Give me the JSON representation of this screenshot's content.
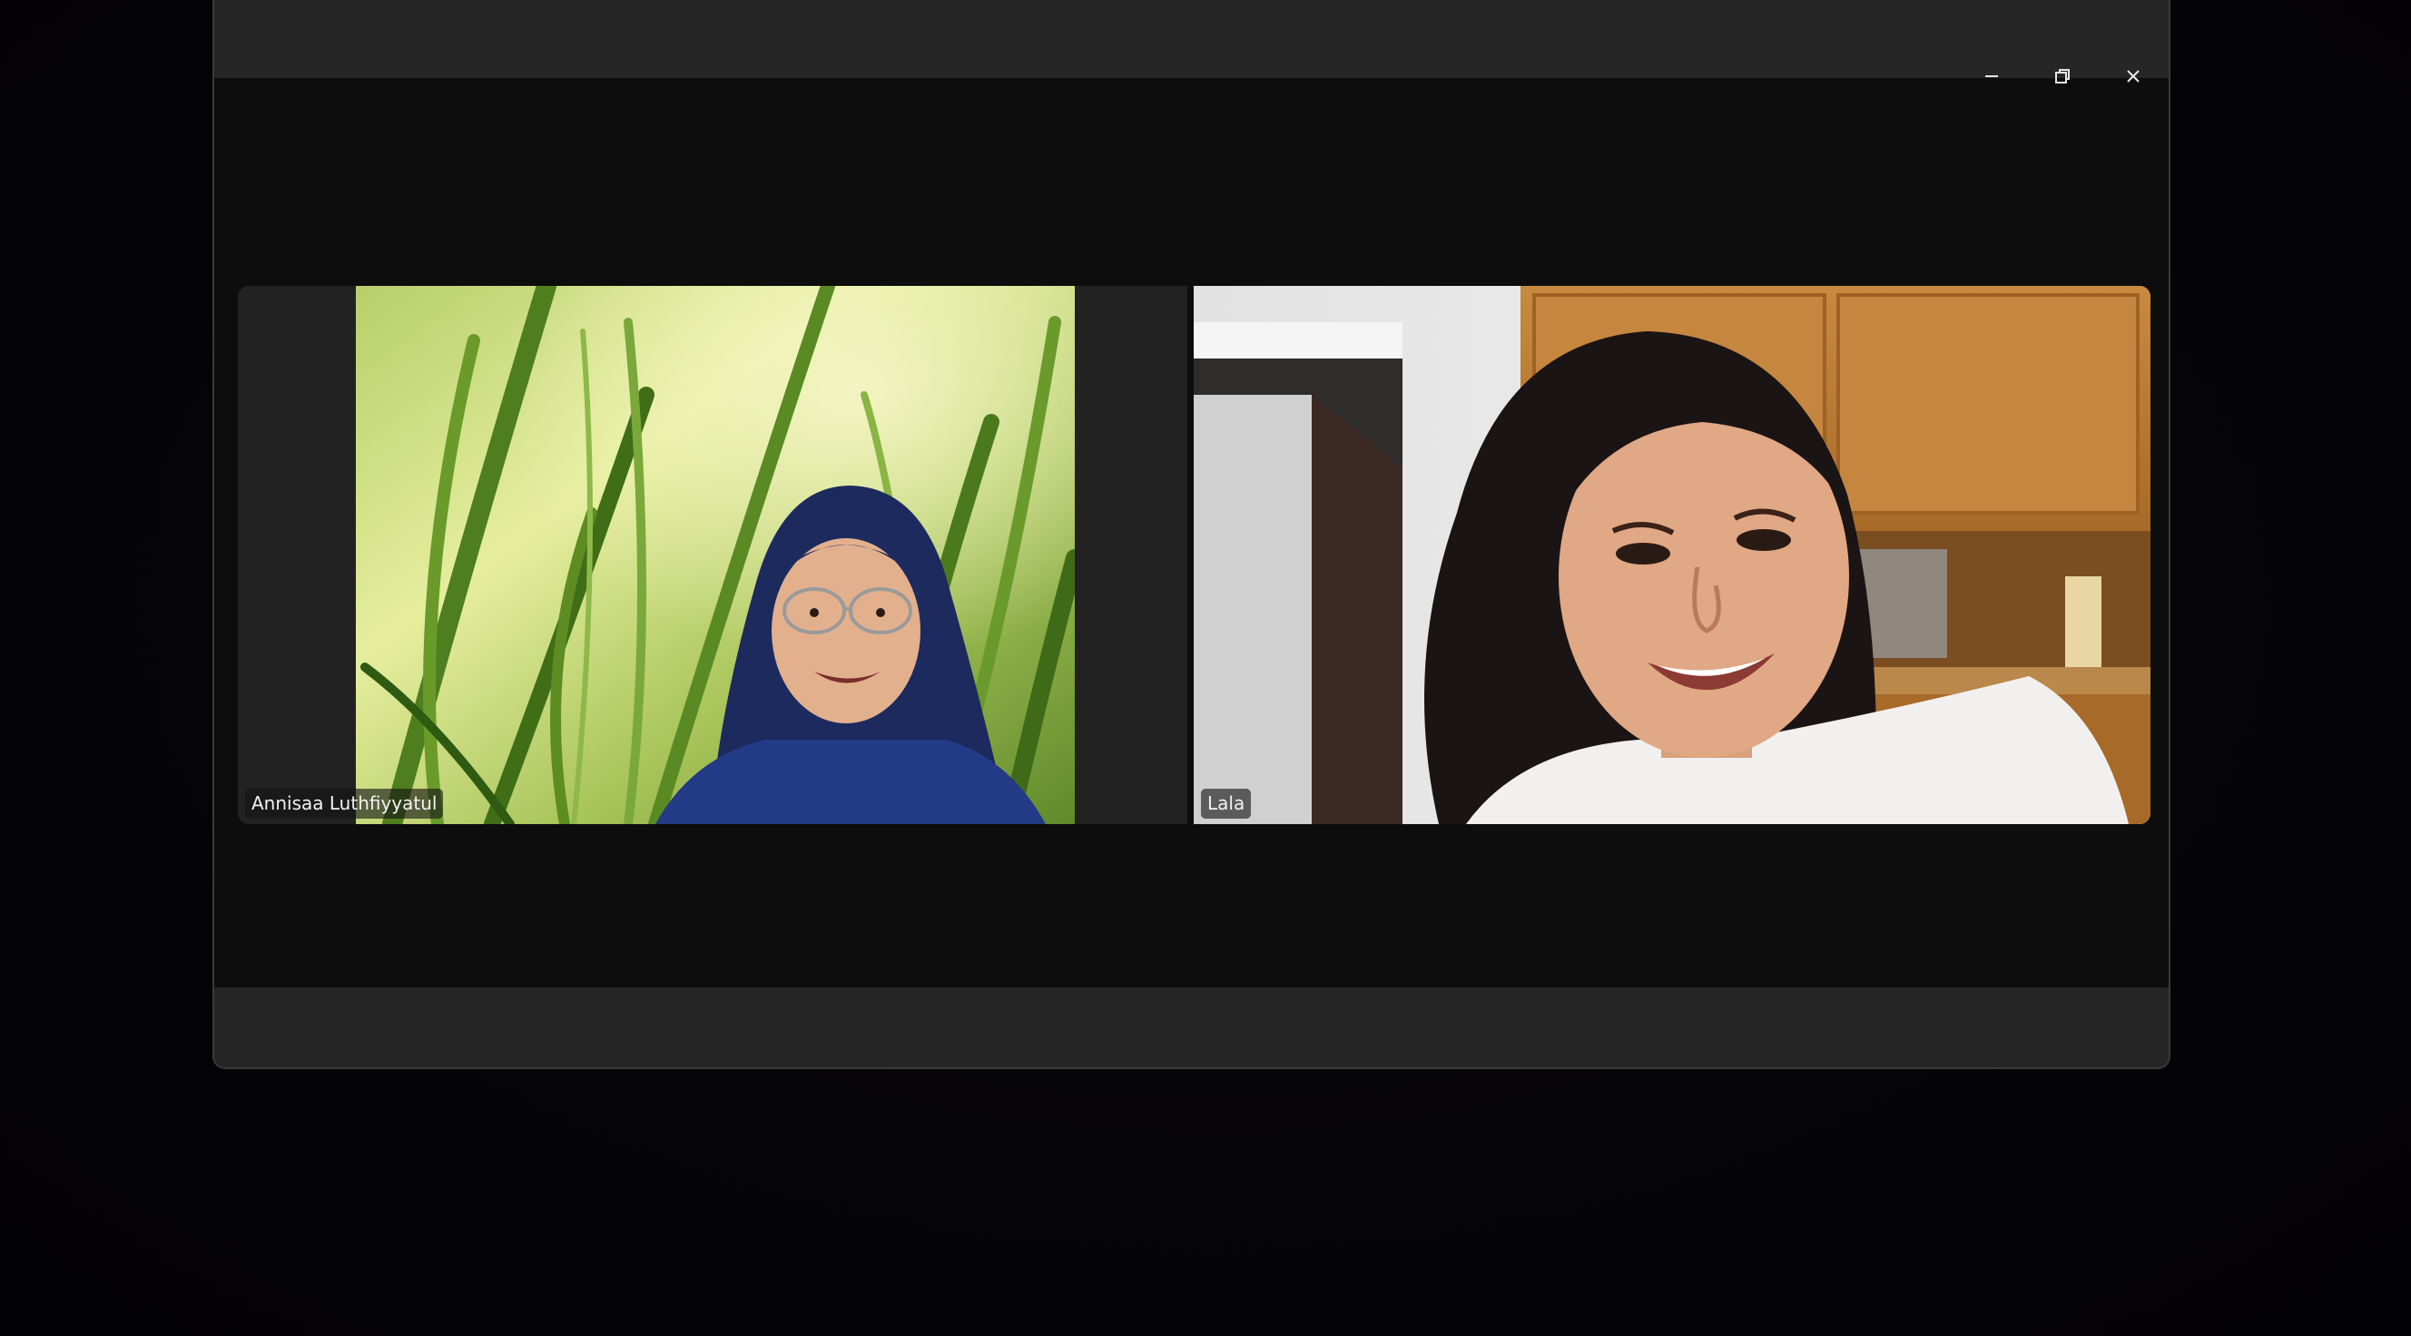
{
  "window": {
    "controls": {
      "minimize": "minimize-icon",
      "restore": "restore-icon",
      "close": "close-icon"
    }
  },
  "participants": [
    {
      "name": "Annisaa Luthfiyyatul"
    },
    {
      "name": "Lala"
    }
  ],
  "colors": {
    "window_bg": "#0d0d0d",
    "bar_bg": "#262626",
    "tile_bg": "#222222",
    "desktop_bg": "#040306"
  }
}
